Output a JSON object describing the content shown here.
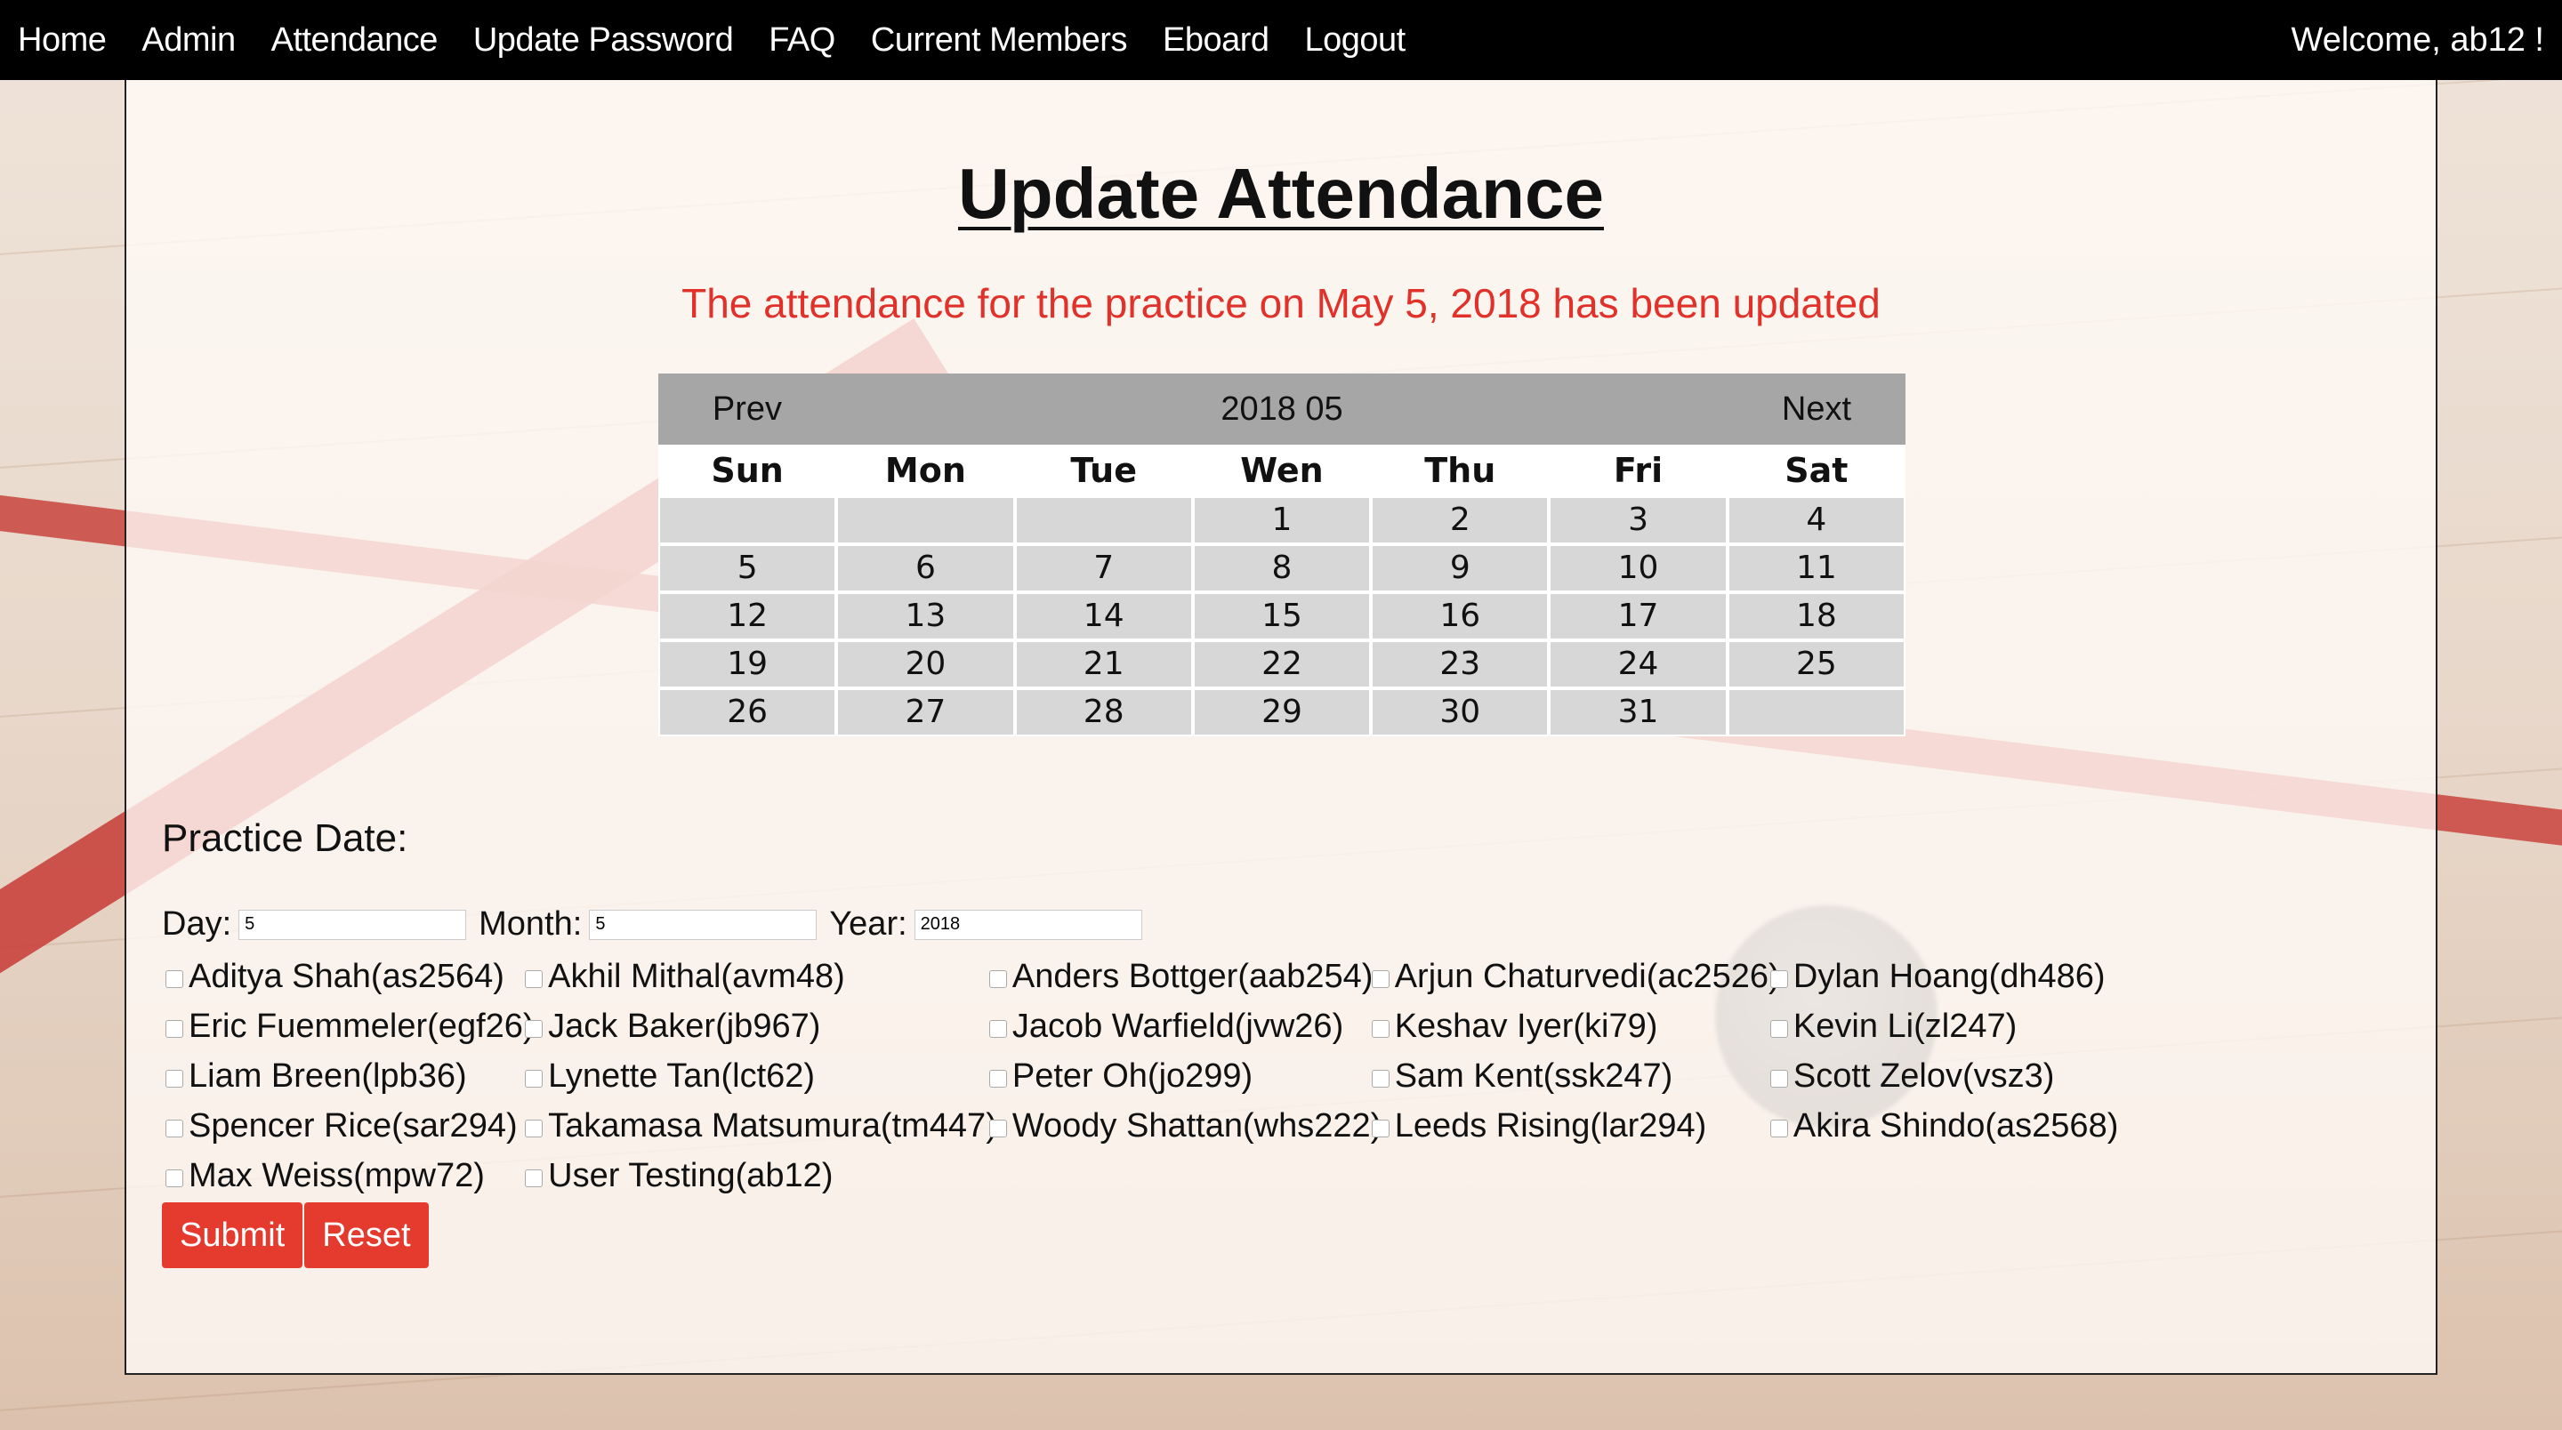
{
  "nav": {
    "items": [
      "Home",
      "Admin",
      "Attendance",
      "Update Password",
      "FAQ",
      "Current Members",
      "Eboard",
      "Logout"
    ],
    "welcome": "Welcome, ab12 !"
  },
  "page": {
    "title": "Update Attendance",
    "status_message": "The attendance for the practice on May 5, 2018 has been updated"
  },
  "calendar": {
    "prev": "Prev",
    "month_label": "2018 05",
    "next": "Next",
    "weekdays": [
      "Sun",
      "Mon",
      "Tue",
      "Wen",
      "Thu",
      "Fri",
      "Sat"
    ],
    "weeks": [
      [
        "",
        "",
        "",
        "1",
        "2",
        "3",
        "4"
      ],
      [
        "5",
        "6",
        "7",
        "8",
        "9",
        "10",
        "11"
      ],
      [
        "12",
        "13",
        "14",
        "15",
        "16",
        "17",
        "18"
      ],
      [
        "19",
        "20",
        "21",
        "22",
        "23",
        "24",
        "25"
      ],
      [
        "26",
        "27",
        "28",
        "29",
        "30",
        "31",
        ""
      ]
    ]
  },
  "practice": {
    "label": "Practice Date:",
    "day_label": "Day:",
    "day_value": "5",
    "month_label": "Month:",
    "month_value": "5",
    "year_label": "Year:",
    "year_value": "2018"
  },
  "members": [
    [
      "Aditya Shah(as2564)",
      "Akhil Mithal(avm48)",
      "Anders Bottger(aab254)",
      "Arjun Chaturvedi(ac2526)",
      "Dylan Hoang(dh486)"
    ],
    [
      "Eric Fuemmeler(egf26)",
      "Jack Baker(jb967)",
      "Jacob Warfield(jvw26)",
      "Keshav Iyer(ki79)",
      "Kevin Li(zl247)"
    ],
    [
      "Liam Breen(lpb36)",
      "Lynette Tan(lct62)",
      "Peter Oh(jo299)",
      "Sam Kent(ssk247)",
      "Scott Zelov(vsz3)"
    ],
    [
      "Spencer Rice(sar294)",
      "Takamasa Matsumura(tm447)",
      "Woody Shattan(whs222)",
      "Leeds Rising(lar294)",
      "Akira Shindo(as2568)"
    ],
    [
      "Max Weiss(mpw72)",
      "User Testing(ab12)"
    ]
  ],
  "buttons": {
    "submit": "Submit",
    "reset": "Reset"
  },
  "colors": {
    "accent": "#e53a2e",
    "status_text": "#e0322a",
    "navbar": "#000000",
    "calendar_header": "#a6a6a6",
    "calendar_cell": "#d7d7d7"
  }
}
